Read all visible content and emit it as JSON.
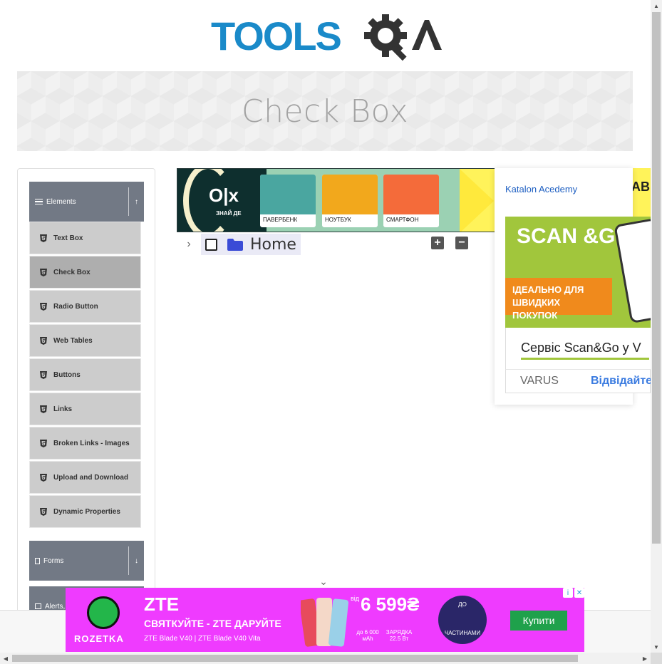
{
  "logo": {
    "text_tools": "TOOLS",
    "text_qa": "QA"
  },
  "page_title": "Check Box",
  "sidebar": {
    "groups": [
      {
        "label": "Elements",
        "toggle_icon": "arrow-up-icon"
      },
      {
        "label": "Forms",
        "toggle_icon": "arrow-down-icon"
      },
      {
        "label": "Alerts,",
        "toggle_icon": "arrow-down-icon"
      }
    ],
    "items": [
      {
        "label": "Text Box"
      },
      {
        "label": "Check Box",
        "active": true
      },
      {
        "label": "Radio Button"
      },
      {
        "label": "Web Tables"
      },
      {
        "label": "Buttons"
      },
      {
        "label": "Links"
      },
      {
        "label": "Broken Links - Images"
      },
      {
        "label": "Upload and Download"
      },
      {
        "label": "Dynamic Properties"
      }
    ]
  },
  "tree": {
    "node_label": "Home",
    "expand_all": "+",
    "collapse_all": "−"
  },
  "ads": {
    "olx": {
      "brand": "O|x",
      "tagline": "ЗНАЙ ДЕ",
      "cards": [
        "ПАВЕРБЕНК",
        "НОУТБУК",
        "СМАРТФОН"
      ],
      "accent": "#9bd1b3"
    },
    "right": {
      "katalon_alt": "Katalon Acedemy",
      "scan_title": "SCAN &GO",
      "scan_sub": "ІДЕАЛЬНО ДЛЯ ШВИДКИХ ПОКУПОК",
      "service": "Сервіс Scan&Go у V",
      "brand": "VARUS",
      "visit": "Відвідайте",
      "strip": "AB"
    },
    "rozetka": {
      "logo": "ROZETKA",
      "title": "ZTE",
      "slogan": "СВЯТКУЙТЕ - ZTE ДАРУЙТЕ",
      "models": "ZTE Blade V40 | ZTE Blade V40 Vita",
      "price_from": "від",
      "price": "6 599₴",
      "spec_battery": "до 6 000 мАh",
      "spec_charge": "ЗАРЯДКА 22.5 Вт",
      "installments_top": "ДО",
      "installments_bottom": "ЧАСТИНАМИ",
      "buy": "Купити",
      "bg": "#ef3bff"
    }
  }
}
